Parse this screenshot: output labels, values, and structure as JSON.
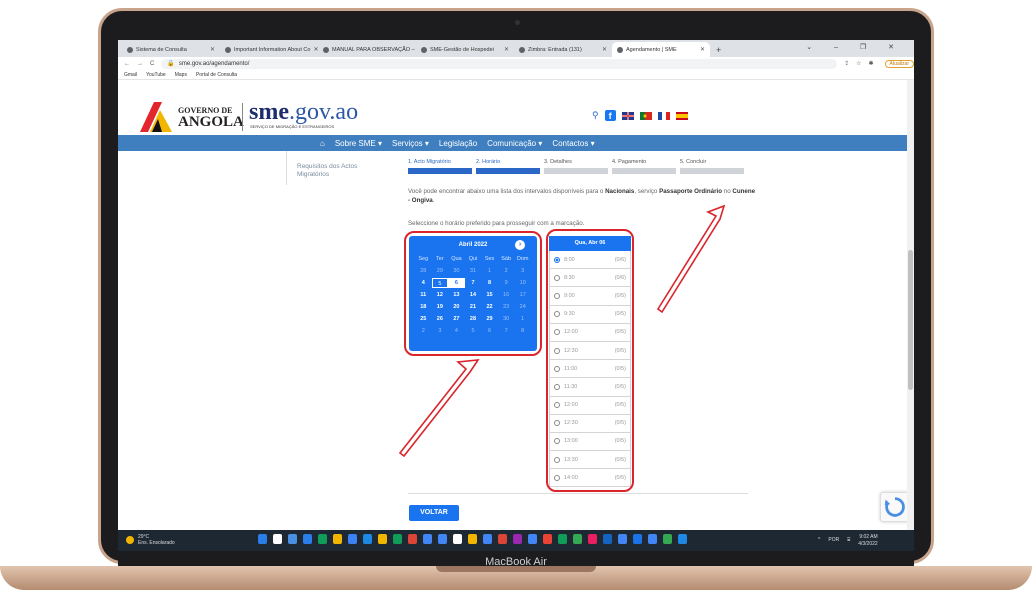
{
  "browser": {
    "tabs": [
      {
        "label": "Sistema de Consulta"
      },
      {
        "label": "Important Information About Co"
      },
      {
        "label": "MANUAL PARA OBSERVAÇÃO –"
      },
      {
        "label": "SME-Gestão de Hospedei"
      },
      {
        "label": "Zimbra: Entrada (131)"
      },
      {
        "label": "Agendamento | SME"
      }
    ],
    "url": "sme.gov.ao/agendamento/",
    "profile_label": "Atualizar",
    "bookmarks": [
      "Gmail",
      "YouTube",
      "Maps",
      "Portal de Consulta"
    ]
  },
  "header": {
    "gov_line1": "GOVERNO DE",
    "gov_line2": "ANGOLA",
    "site_name_bold": "sme",
    "site_name_rest": ".gov.ao",
    "subtitle": "SERVIÇO DE MIGRAÇÃO E ESTRANGEIROS"
  },
  "nav": [
    "Sobre SME ▾",
    "Serviços ▾",
    "Legislação",
    "Comunicação ▾",
    "Contactos ▾"
  ],
  "sidebar": {
    "line1": "Requisitos dos Actos",
    "line2": "Migratórios"
  },
  "steps": [
    {
      "label": "1. Acto Migratório",
      "active": true
    },
    {
      "label": "2. Horário",
      "active": true
    },
    {
      "label": "3. Detalhes",
      "active": false
    },
    {
      "label": "4. Pagamento",
      "active": false
    },
    {
      "label": "5. Concluir",
      "active": false
    }
  ],
  "info": {
    "prefix": "Você pode encontrar abaixo uma lista dos intervalos disponíveis para o ",
    "place": "Nacionais",
    "mid": ", serviço ",
    "service": "Passaporte Ordinário",
    "post": " no ",
    "location": "Cunene - Ongiva",
    "end": "."
  },
  "hint": "Seleccione o horário preferido para prosseguir com a marcação.",
  "calendar": {
    "month_label": "Abril 2022",
    "next_icon": "›",
    "weekdays": [
      "Seg",
      "Ter",
      "Qua",
      "Qui",
      "Sex",
      "Sáb",
      "Dom"
    ],
    "days": [
      [
        "28",
        "29",
        "30",
        "31",
        "1",
        "2",
        "3"
      ],
      [
        "4",
        "5",
        "6",
        "7",
        "8",
        "9",
        "10"
      ],
      [
        "11",
        "12",
        "13",
        "14",
        "15",
        "16",
        "17"
      ],
      [
        "18",
        "19",
        "20",
        "21",
        "22",
        "23",
        "24"
      ],
      [
        "25",
        "26",
        "27",
        "28",
        "29",
        "30",
        "1"
      ],
      [
        "2",
        "3",
        "4",
        "5",
        "6",
        "7",
        "8"
      ]
    ]
  },
  "times": {
    "header": "Qua, Abr 06",
    "slots": [
      {
        "time": "8:00",
        "cap": "(0/6)",
        "selected": true
      },
      {
        "time": "8:30",
        "cap": "(0/6)",
        "selected": false
      },
      {
        "time": "9:00",
        "cap": "(0/5)",
        "selected": false
      },
      {
        "time": "9:30",
        "cap": "(0/5)",
        "selected": false
      },
      {
        "time": "12:00",
        "cap": "(0/5)",
        "selected": false
      },
      {
        "time": "12:30",
        "cap": "(0/5)",
        "selected": false
      },
      {
        "time": "11:00",
        "cap": "(0/5)",
        "selected": false
      },
      {
        "time": "11:30",
        "cap": "(0/5)",
        "selected": false
      },
      {
        "time": "12:00",
        "cap": "(0/5)",
        "selected": false
      },
      {
        "time": "12:30",
        "cap": "(0/5)",
        "selected": false
      },
      {
        "time": "13:00",
        "cap": "(0/5)",
        "selected": false
      },
      {
        "time": "13:30",
        "cap": "(0/5)",
        "selected": false
      },
      {
        "time": "14:00",
        "cap": "(0/5)",
        "selected": false
      }
    ]
  },
  "back_label": "VOLTAR",
  "taskbar": {
    "weather_temp": "29°C",
    "weather_desc": "Ens. Ensolarado",
    "lang": "POR",
    "time": "9:02 AM",
    "date": "4/3/2022"
  },
  "laptop_label": "MacBook Air",
  "colors": {
    "accent": "#1a74f0",
    "nav": "#3f7fbf",
    "annotation": "#d9252b"
  }
}
